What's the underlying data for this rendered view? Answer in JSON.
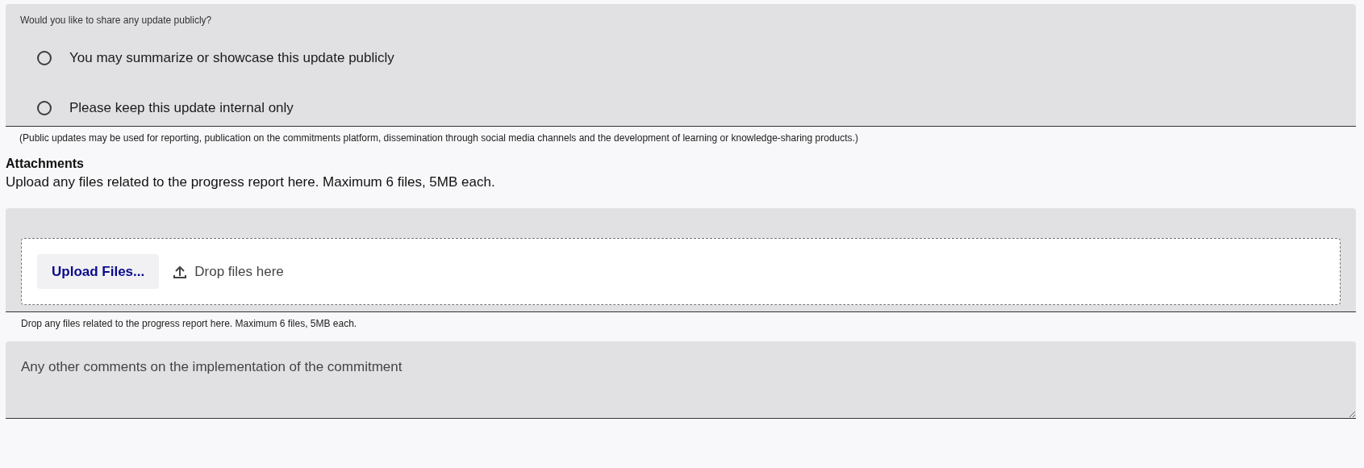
{
  "share_question": {
    "label": "Would you like to share any update publicly?",
    "options": [
      {
        "label": "You may summarize or showcase this update publicly",
        "selected": false
      },
      {
        "label": "Please keep this update internal only",
        "selected": false
      }
    ],
    "note": "(Public updates may be used for reporting, publication on the commitments platform, dissemination through social media channels and the development of learning or knowledge-sharing products.)"
  },
  "attachments": {
    "heading": "Attachments",
    "description": "Upload any files related to the progress report here. Maximum 6 files, 5MB each.",
    "button": "Upload Files...",
    "drop_label": "Drop files here",
    "hint": "Drop any files related to the progress report here. Maximum 6 files, 5MB each."
  },
  "comments": {
    "placeholder": "Any other comments on the implementation of the commitment"
  }
}
